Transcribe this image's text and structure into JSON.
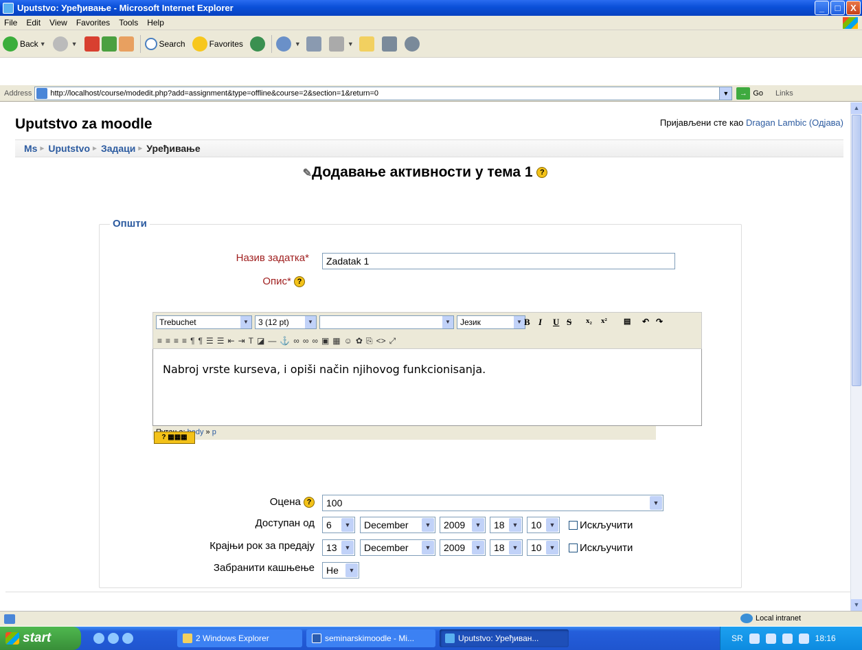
{
  "window": {
    "title": "Uputstvo: Уређивање - Microsoft Internet Explorer",
    "controls": {
      "minimize": "_",
      "maximize": "□",
      "close": "X"
    }
  },
  "menu": [
    "File",
    "Edit",
    "View",
    "Favorites",
    "Tools",
    "Help"
  ],
  "toolbar": {
    "back": "Back",
    "search": "Search",
    "favorites": "Favorites"
  },
  "address": {
    "label": "Address",
    "url": "http://localhost/course/modedit.php?add=assignment&type=offline&course=2&section=1&return=0",
    "go": "Go",
    "links": "Links"
  },
  "page": {
    "site_name": "Uputstvo za moodle",
    "login": {
      "prefix": "Пријављени сте као",
      "user": "Dragan Lambic",
      "logout": "(Одјава)"
    },
    "breadcrumb": [
      "Ms",
      "Uputstvo",
      "Задаци",
      "Уређивање"
    ],
    "heading": "Додавање активности у тема 1",
    "fieldset_legend": "Општи",
    "name": {
      "label": "Назив задатка",
      "required": "*",
      "value": "Zadatak 1"
    },
    "description": {
      "label": "Опис",
      "required": "*"
    },
    "editor": {
      "font": "Trebuchet",
      "size": "3 (12 pt)",
      "style": "",
      "language": "Језик",
      "bold": "B",
      "italic": "I",
      "underline": "U",
      "strike": "S",
      "content": "Nabroj vrste kurseva, i opiši način njihovog funkcionisanja.",
      "path_label": "Путања:",
      "path_body": "body",
      "path_sep": "»",
      "path_p": "p"
    },
    "grade": {
      "label": "Оцена",
      "value": "100"
    },
    "available_from": {
      "label": "Доступан од",
      "day": "6",
      "month": "December",
      "year": "2009",
      "hour": "18",
      "minute": "10",
      "disable": "Искључити"
    },
    "due_date": {
      "label": "Крајњи рок за предају",
      "day": "13",
      "month": "December",
      "year": "2009",
      "hour": "18",
      "minute": "10",
      "disable": "Искључити"
    },
    "prevent_late": {
      "label": "Забранити кашњење",
      "value": "Не"
    }
  },
  "statusbar": {
    "zone": "Local intranet"
  },
  "taskbar": {
    "start": "start",
    "tasks": [
      "2 Windows Explorer",
      "seminarskimoodle - Mi...",
      "Uputstvo: Уређиван..."
    ],
    "lang": "SR",
    "clock": "18:16"
  },
  "colors": {
    "link": "#2c5ba0",
    "required": "#a02020",
    "titlebar": "#0a4fd8",
    "taskbar": "#245edb"
  }
}
